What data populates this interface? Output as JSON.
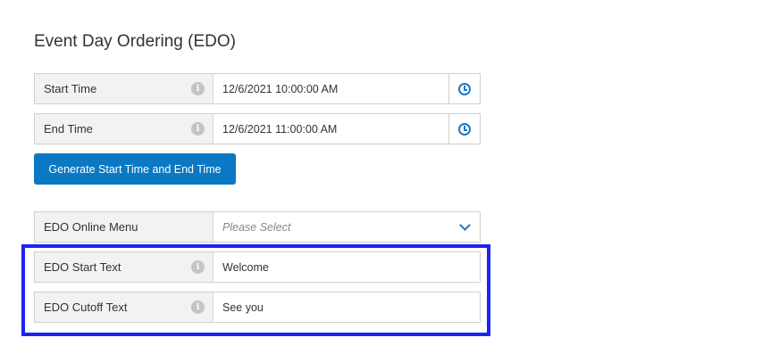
{
  "section": {
    "title": "Event Day Ordering (EDO)"
  },
  "fields": {
    "start_time": {
      "label": "Start Time",
      "value": "12/6/2021 10:00:00 AM"
    },
    "end_time": {
      "label": "End Time",
      "value": "12/6/2021 11:00:00 AM"
    },
    "generate_button": {
      "label": "Generate Start Time and End Time"
    },
    "online_menu": {
      "label": "EDO Online Menu",
      "placeholder": "Please Select"
    },
    "start_text": {
      "label": "EDO Start Text",
      "value": "Welcome"
    },
    "cutoff_text": {
      "label": "EDO Cutoff Text",
      "value": "See you"
    }
  },
  "icons": {
    "info": "info-icon",
    "clock": "clock-icon",
    "dropdown": "chevron-down-icon"
  },
  "colors": {
    "accent": "#0a78c2",
    "highlight": "#1c25f0",
    "label_bg": "#f2f2f2"
  }
}
